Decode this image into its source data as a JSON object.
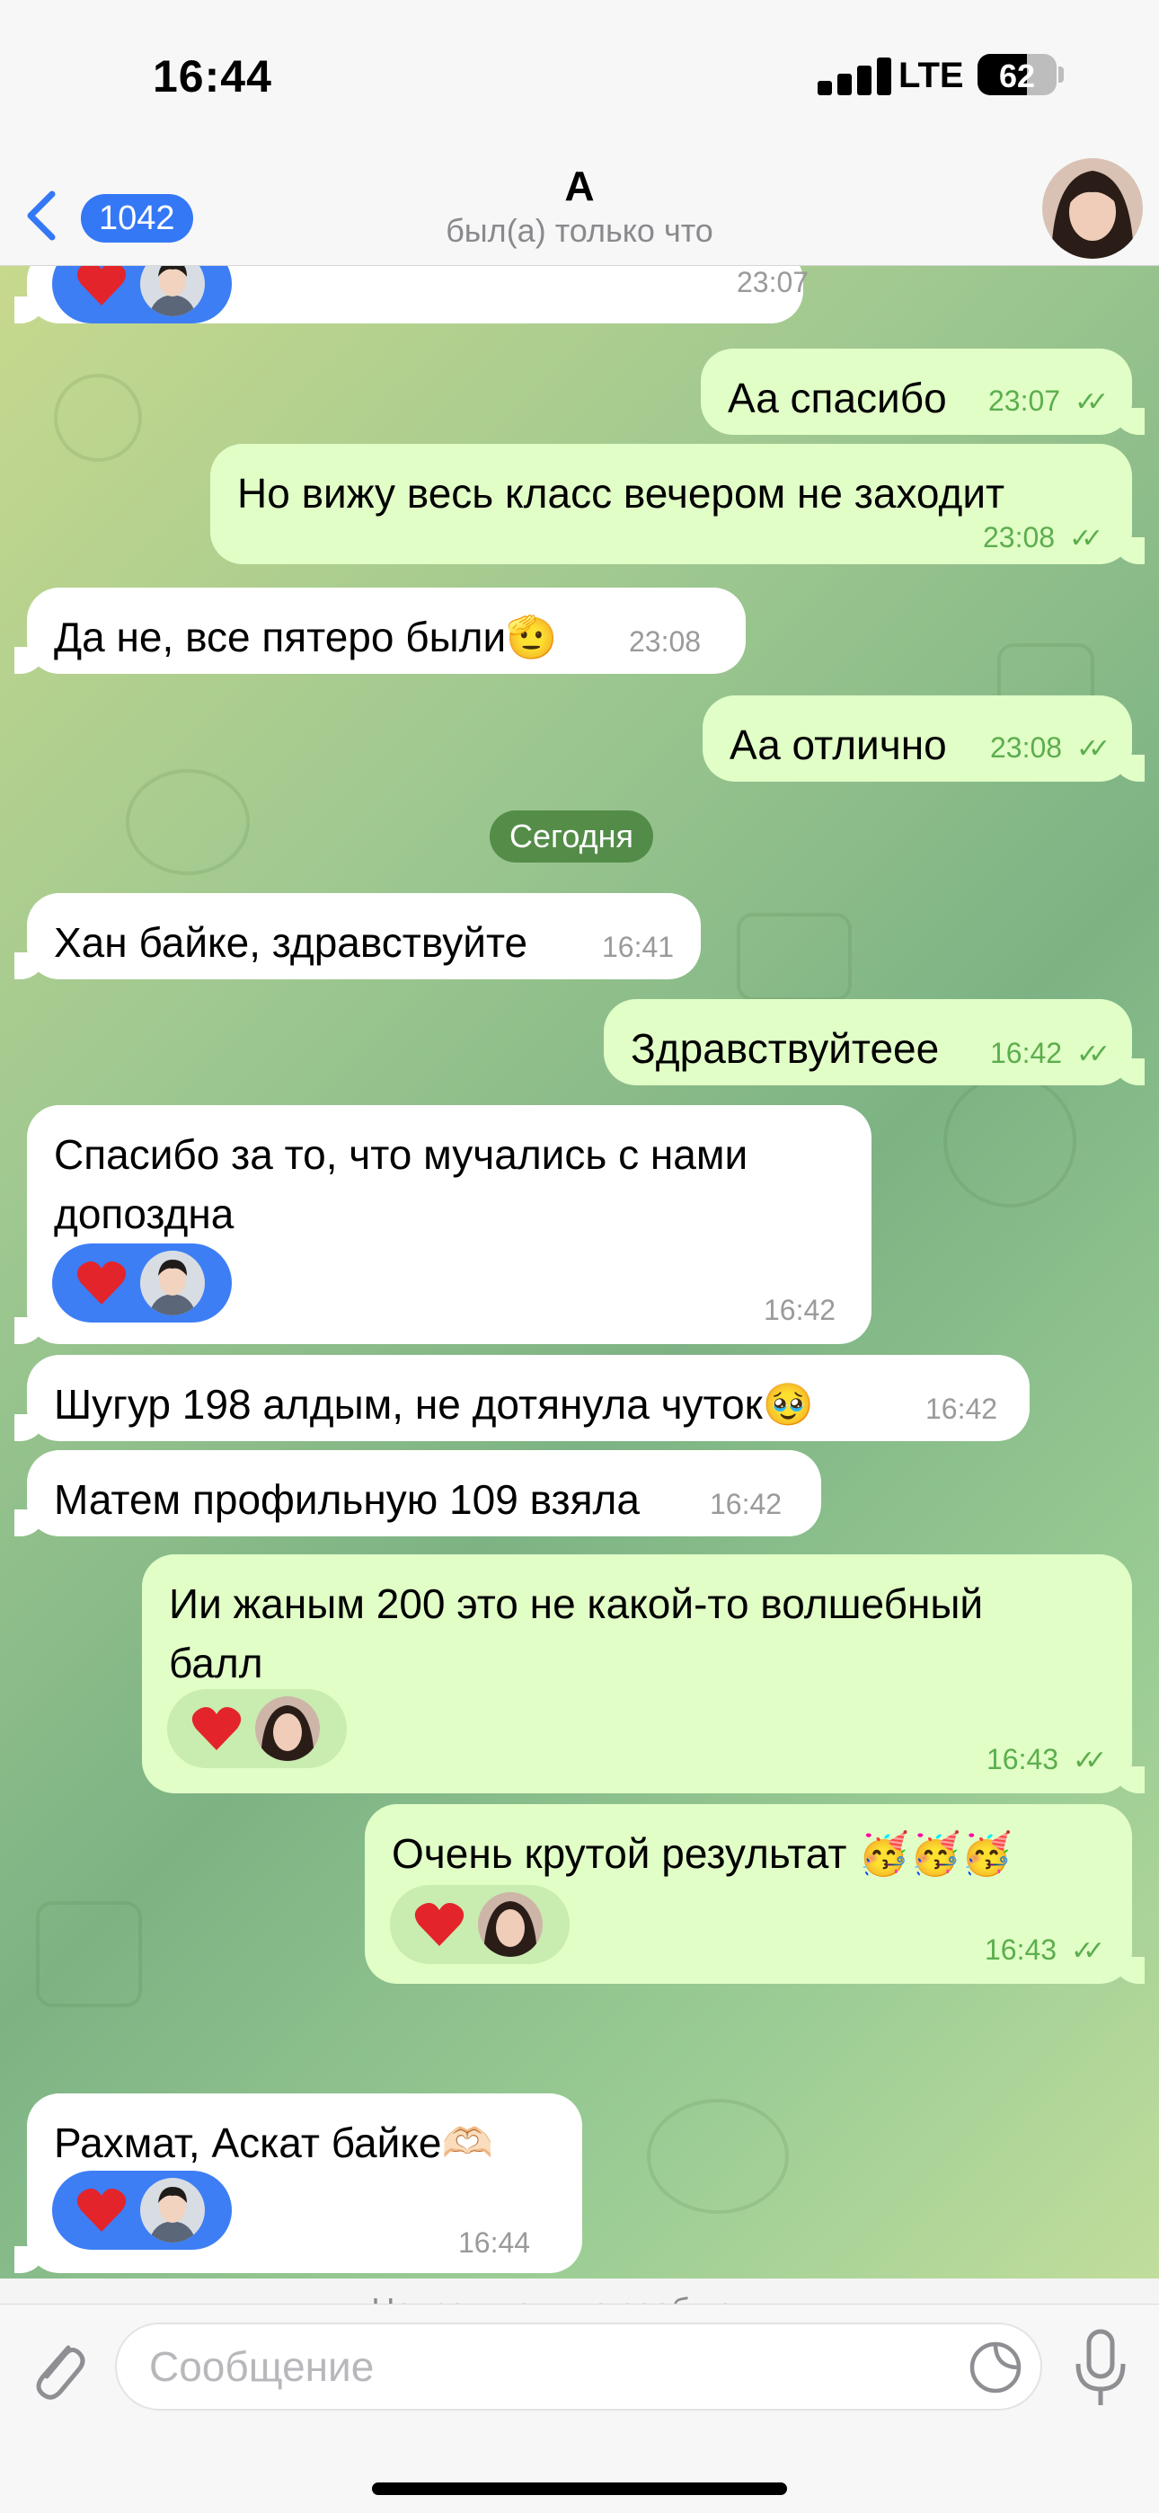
{
  "status": {
    "time": "16:44",
    "network": "LTE",
    "battery": "62",
    "battery_level": 0.62
  },
  "header": {
    "back_count": "1042",
    "title": "А",
    "subtitle": "был(а) только что"
  },
  "divider": {
    "today": "Сегодня",
    "unread": "Непрочитанные сообщения"
  },
  "messages": [
    {
      "dir": "in",
      "text": "",
      "time": "23:07",
      "reaction": true,
      "reactor": "male"
    },
    {
      "dir": "out",
      "text": "Аа спасибо",
      "time": "23:07"
    },
    {
      "dir": "out",
      "text": "Но вижу весь класс вечером не заходит",
      "time": "23:08"
    },
    {
      "dir": "in",
      "text": "Да не, все пятеро были🫡",
      "time": "23:08"
    },
    {
      "dir": "out",
      "text": "Аа отлично",
      "time": "23:08"
    },
    {
      "dir": "in",
      "text": "Хан байке, здравствуйте",
      "time": "16:41"
    },
    {
      "dir": "out",
      "text": "Здравствуйтеее",
      "time": "16:42"
    },
    {
      "dir": "in",
      "text": "Спасибо за то, что мучались с нами\nдопоздна",
      "time": "16:42",
      "reaction": true,
      "reactor": "male"
    },
    {
      "dir": "in",
      "text": "Шугур 198 алдым, не дотянула чуток🥹",
      "time": "16:42"
    },
    {
      "dir": "in",
      "text": "Матем профильную 109 взяла",
      "time": "16:42"
    },
    {
      "dir": "out",
      "text": "Ии жаным 200 это не какой-то волшебный\nбалл",
      "time": "16:43",
      "reaction": true,
      "reactor": "female"
    },
    {
      "dir": "out",
      "text": "Очень крутой результат 🥳🥳🥳",
      "time": "16:43",
      "reaction": true,
      "reactor": "female"
    },
    {
      "dir": "in",
      "text": "Рахмат, Аскат байке🫶🏻",
      "time": "16:44",
      "reaction": true,
      "reactor": "male"
    }
  ],
  "input": {
    "placeholder": "Сообщение"
  },
  "colors": {
    "accent": "#3478f6",
    "outgoing": "#e1fec7",
    "incoming": "#ffffff",
    "check": "#5cae4d"
  }
}
